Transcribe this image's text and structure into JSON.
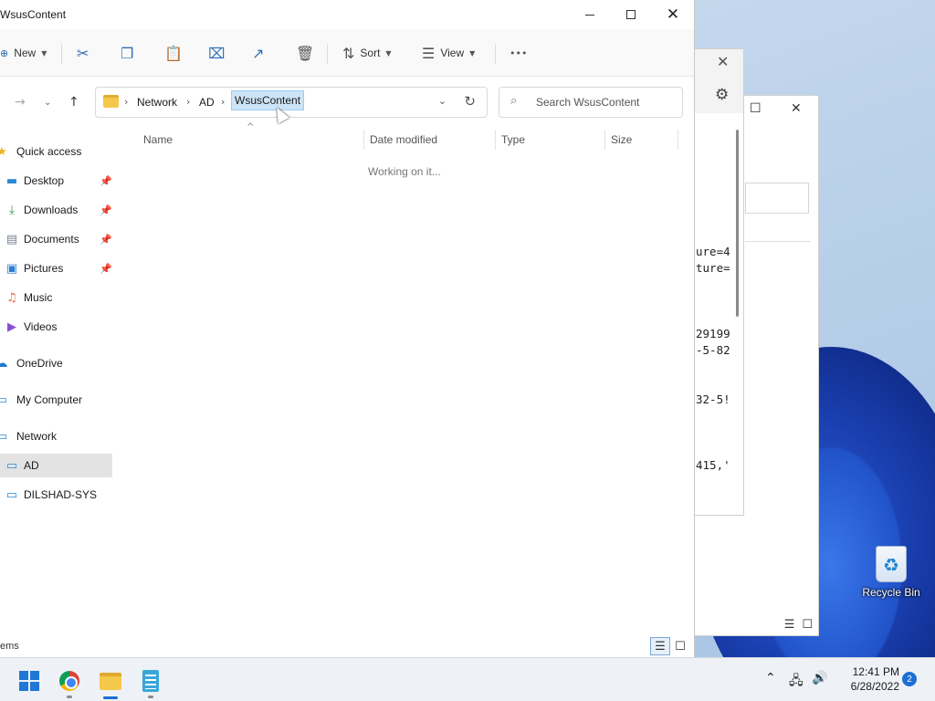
{
  "explorer": {
    "title": "WsusContent",
    "toolbar": {
      "new_label": "New",
      "sort_label": "Sort",
      "view_label": "View",
      "more_glyph": "•••"
    },
    "breadcrumb": [
      "Network",
      "AD",
      "WsusContent"
    ],
    "search_placeholder": "Search WsusContent",
    "columns": [
      "Name",
      "Date modified",
      "Type",
      "Size"
    ],
    "status_message": "Working on it...",
    "status_bar_text": "ems",
    "sidebar": [
      {
        "label": "Quick access",
        "icon": "star-icon",
        "pinned": false
      },
      {
        "label": "Desktop",
        "icon": "desktop-icon",
        "pinned": true
      },
      {
        "label": "Downloads",
        "icon": "download-icon",
        "pinned": true
      },
      {
        "label": "Documents",
        "icon": "document-icon",
        "pinned": true
      },
      {
        "label": "Pictures",
        "icon": "pictures-icon",
        "pinned": true
      },
      {
        "label": "Music",
        "icon": "music-icon",
        "pinned": false
      },
      {
        "label": "Videos",
        "icon": "videos-icon",
        "pinned": false
      },
      {
        "label": "OneDrive",
        "icon": "cloud-icon",
        "pinned": false
      },
      {
        "label": "My Computer",
        "icon": "computer-icon",
        "pinned": false
      },
      {
        "label": "Network",
        "icon": "network-icon",
        "pinned": false
      },
      {
        "label": "AD",
        "icon": "computer-icon",
        "pinned": false,
        "selected": true
      },
      {
        "label": "DILSHAD-SYS",
        "icon": "computer-icon",
        "pinned": false
      }
    ]
  },
  "background_window": {
    "lines": [
      "ure=4",
      "ture=",
      "29199",
      "-5-82",
      "32-5!",
      "415,'"
    ]
  },
  "desktop": {
    "recycle_bin_label": "Recycle Bin"
  },
  "taskbar": {
    "time": "12:41 PM",
    "date": "6/28/2022",
    "notification_count": "2"
  },
  "colors": {
    "accent": "#1b6fd4",
    "selection": "#cce4f7",
    "sidebar_selected": "#e3e3e3"
  }
}
